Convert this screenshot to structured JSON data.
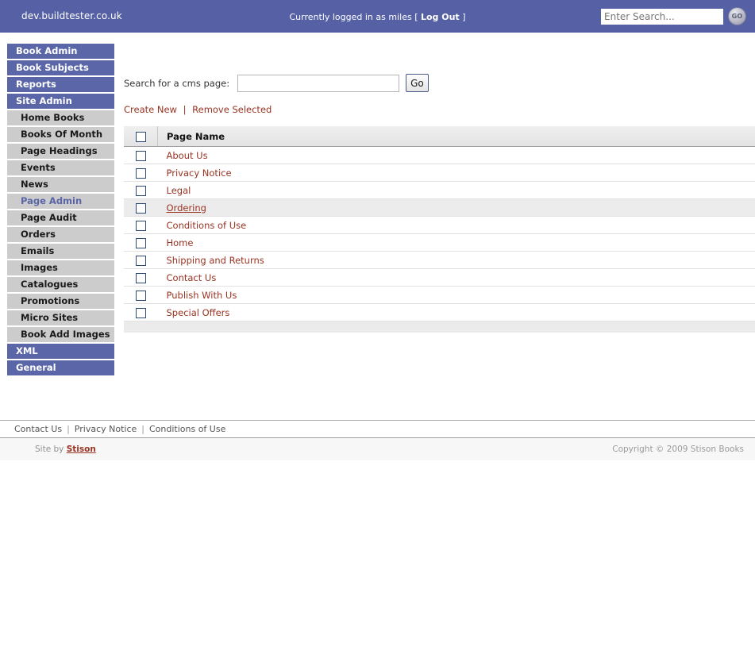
{
  "header": {
    "domain": "dev.buildtester.co.uk",
    "logged_in_prefix": "Currently logged in as miles [",
    "logout_label": "Log Out",
    "logged_in_suffix": "]",
    "search_placeholder": "Enter Search...",
    "search_value": "",
    "go_icon_label": "GO",
    "bg_color": "#5561a4"
  },
  "sidebar": {
    "items": [
      {
        "label": "Book Admin",
        "level": "top",
        "active": false
      },
      {
        "label": "Book Subjects",
        "level": "top",
        "active": false
      },
      {
        "label": "Reports",
        "level": "top",
        "active": false
      },
      {
        "label": "Site Admin",
        "level": "top",
        "active": false
      },
      {
        "label": "Home Books",
        "level": "sub",
        "active": false
      },
      {
        "label": "Books Of Month",
        "level": "sub",
        "active": false
      },
      {
        "label": "Page Headings",
        "level": "sub",
        "active": false
      },
      {
        "label": "Events",
        "level": "sub",
        "active": false
      },
      {
        "label": "News",
        "level": "sub",
        "active": false
      },
      {
        "label": "Page Admin",
        "level": "sub",
        "active": true
      },
      {
        "label": "Page Audit",
        "level": "sub",
        "active": false
      },
      {
        "label": "Orders",
        "level": "sub",
        "active": false
      },
      {
        "label": "Emails",
        "level": "sub",
        "active": false
      },
      {
        "label": "Images",
        "level": "sub",
        "active": false
      },
      {
        "label": "Catalogues",
        "level": "sub",
        "active": false
      },
      {
        "label": "Promotions",
        "level": "sub",
        "active": false
      },
      {
        "label": "Micro Sites",
        "level": "sub",
        "active": false
      },
      {
        "label": "Book Add Images",
        "level": "sub",
        "active": false
      },
      {
        "label": "XML",
        "level": "top",
        "active": false
      },
      {
        "label": "General",
        "level": "top",
        "active": false
      }
    ],
    "top_color": "#5a66a8",
    "sub_color": "#cccccc"
  },
  "main": {
    "search_label": "Search for a cms page:",
    "search_value": "",
    "go_label": "Go",
    "create_new_label": "Create New",
    "links_separator": "|",
    "remove_selected_label": "Remove Selected",
    "link_color": "#993322",
    "table": {
      "columns": [
        "",
        "Page Name"
      ],
      "rows": [
        {
          "name": "About Us",
          "hover": false
        },
        {
          "name": "Privacy Notice",
          "hover": false
        },
        {
          "name": "Legal",
          "hover": false
        },
        {
          "name": "Ordering",
          "hover": true
        },
        {
          "name": "Conditions of Use",
          "hover": false
        },
        {
          "name": "Home",
          "hover": false
        },
        {
          "name": "Shipping and Returns",
          "hover": false
        },
        {
          "name": "Contact Us",
          "hover": false
        },
        {
          "name": "Publish With Us",
          "hover": false
        },
        {
          "name": "Special Offers",
          "hover": false
        }
      ]
    }
  },
  "footer": {
    "links": [
      "Contact Us",
      "Privacy Notice",
      "Conditions of Use"
    ],
    "separator": "|",
    "site_by_prefix": "Site by ",
    "site_by_name": "Stison",
    "copyright": "Copyright © 2009 Stison Books"
  }
}
